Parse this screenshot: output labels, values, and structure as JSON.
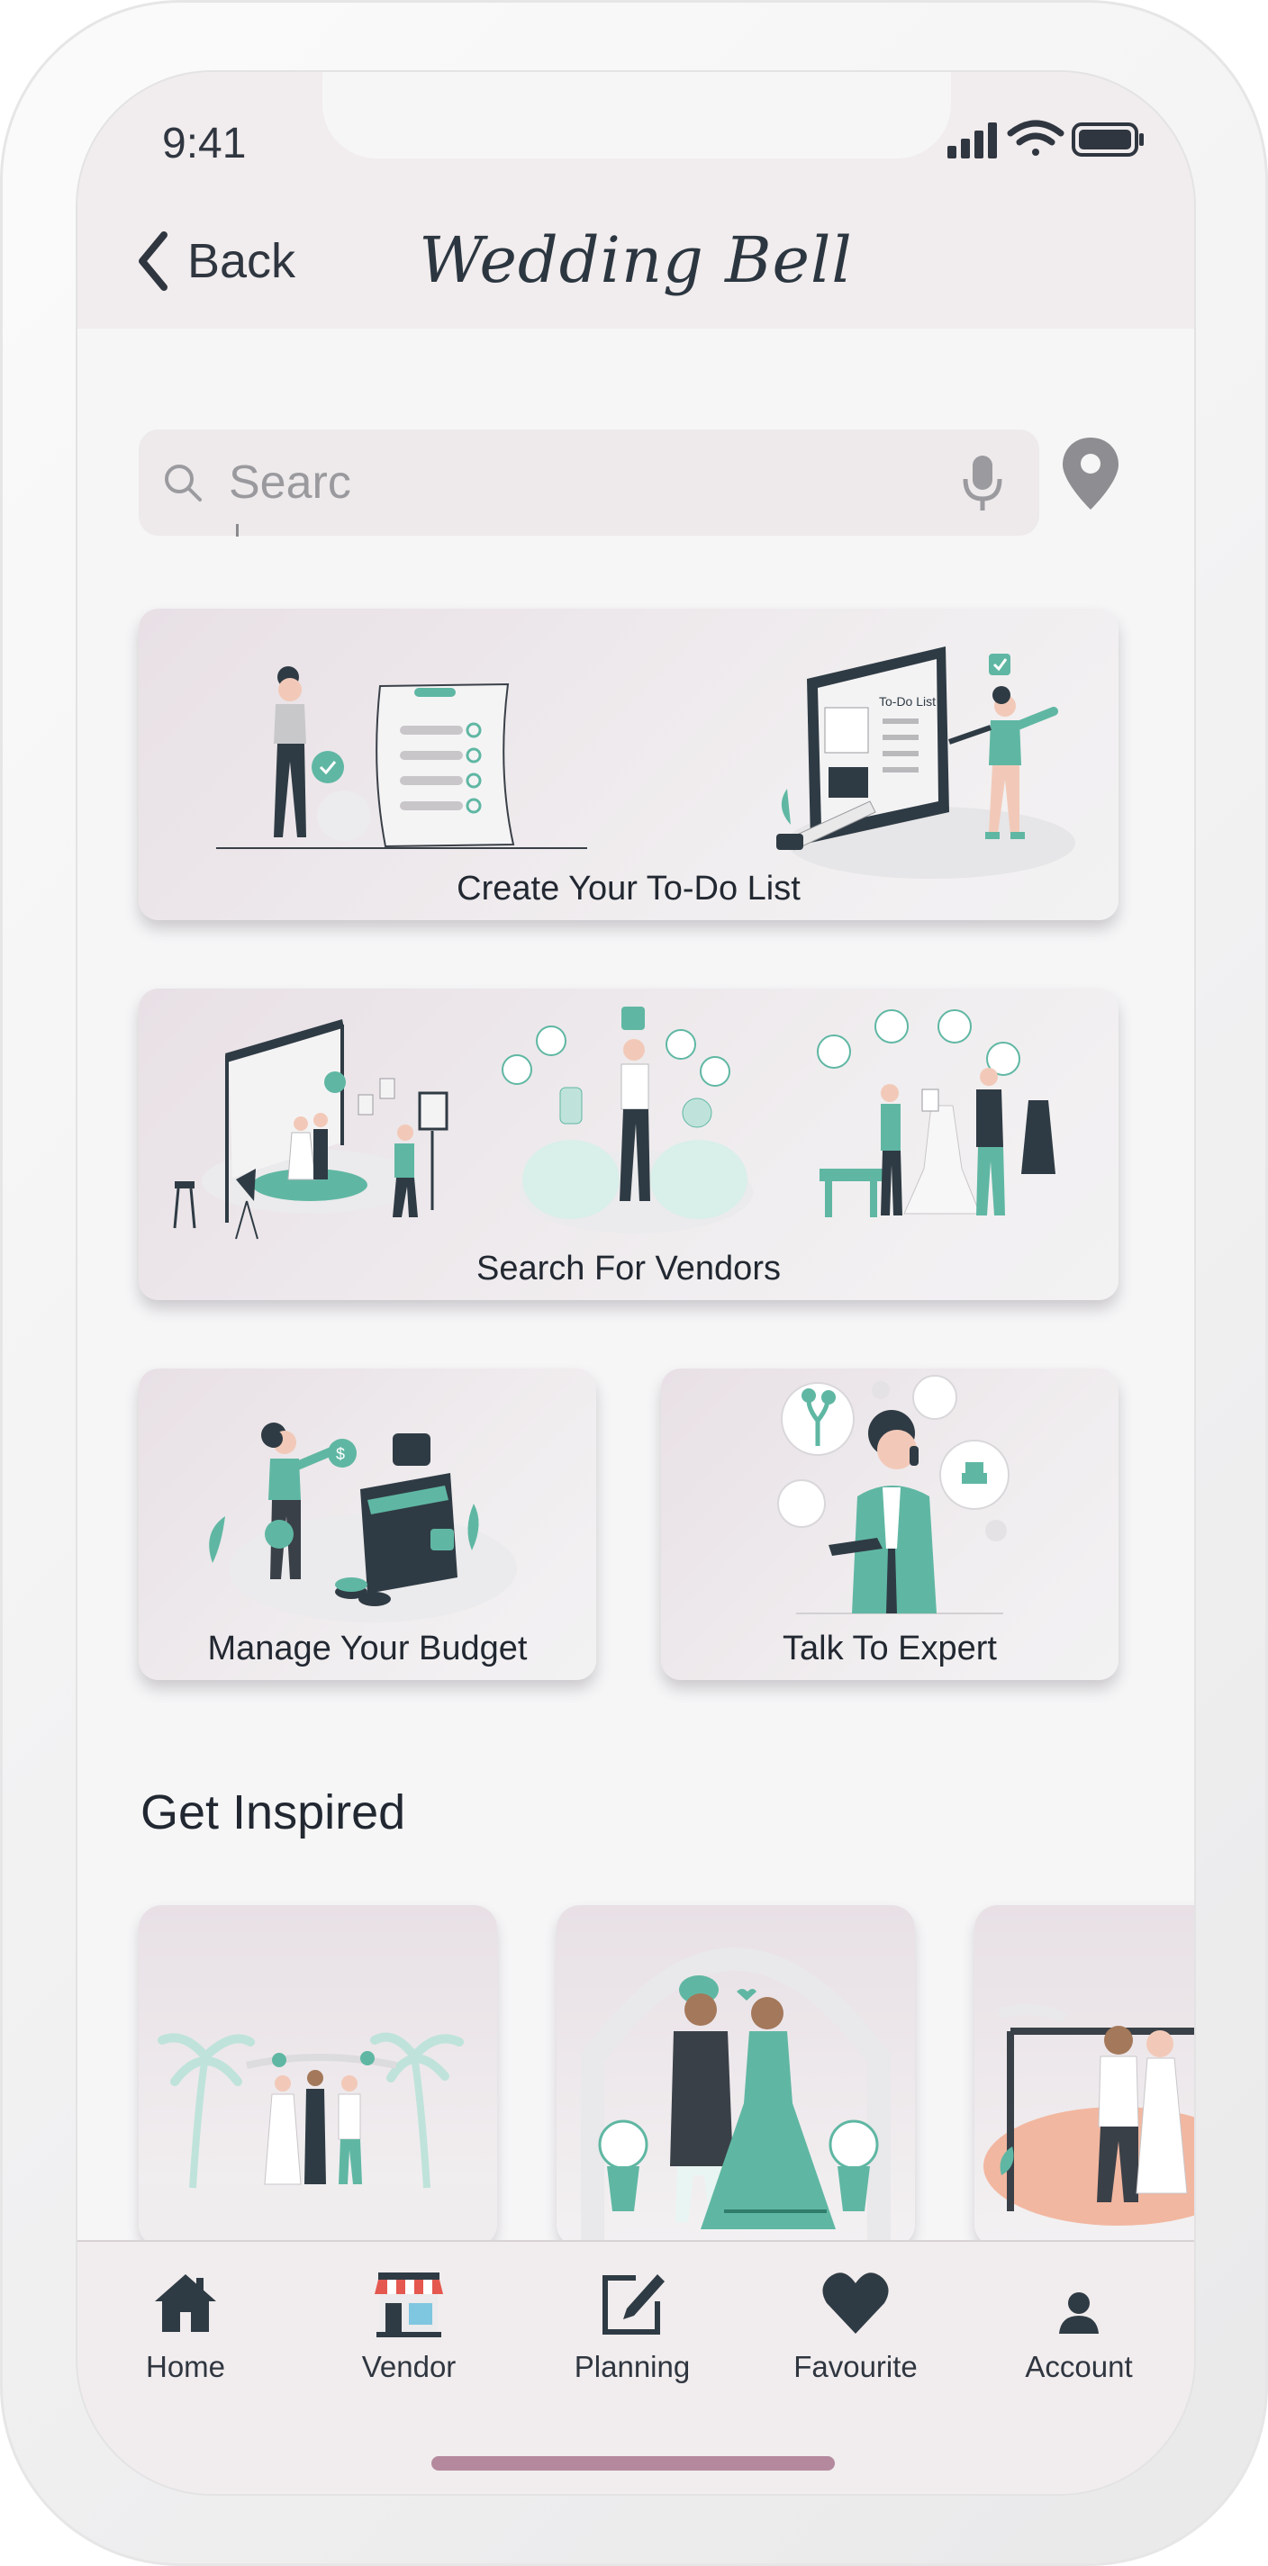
{
  "status_bar": {
    "time": "9:41"
  },
  "header": {
    "back_label": "Back",
    "title": "Wedding Bell"
  },
  "search": {
    "placeholder": "Searc"
  },
  "cards": [
    {
      "label": "Create Your To-Do List"
    },
    {
      "label": "Search For Vendors"
    },
    {
      "label": "Manage Your Budget"
    },
    {
      "label": "Talk To Expert"
    }
  ],
  "inspired": {
    "title": "Get Inspired"
  },
  "nav": [
    {
      "label": "Home",
      "icon": "home-icon"
    },
    {
      "label": "Vendor",
      "icon": "store-icon"
    },
    {
      "label": "Planning",
      "icon": "edit-icon"
    },
    {
      "label": "Favourite",
      "icon": "heart-icon"
    },
    {
      "label": "Account",
      "icon": "user-icon"
    }
  ],
  "colors": {
    "accent": "#5fb7a3",
    "dark": "#2f3b44",
    "header_bg": "#f1eced",
    "indicator": "#b4899e"
  }
}
